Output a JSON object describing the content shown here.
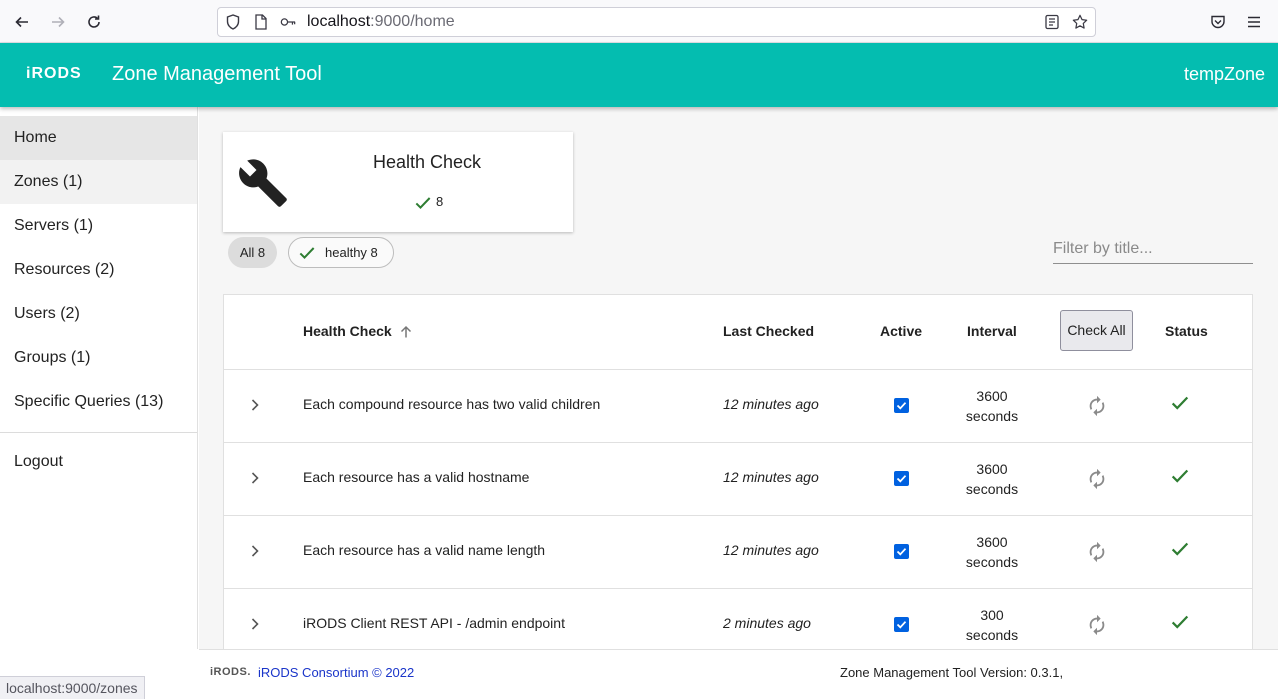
{
  "browser": {
    "url_host": "localhost",
    "url_rest": ":9000/home",
    "status_url": "localhost:9000/zones"
  },
  "header": {
    "logo": "iRODS",
    "title": "Zone Management Tool",
    "zone": "tempZone"
  },
  "sidebar": {
    "items": [
      {
        "label": "Home"
      },
      {
        "label": "Zones (1)"
      },
      {
        "label": "Servers (1)"
      },
      {
        "label": "Resources (2)"
      },
      {
        "label": "Users (2)"
      },
      {
        "label": "Groups (1)"
      },
      {
        "label": "Specific Queries (13)"
      }
    ],
    "logout": "Logout"
  },
  "summary_card": {
    "title": "Health Check",
    "healthy_count": "8"
  },
  "filters": {
    "all_label": "All 8",
    "healthy_label": "healthy 8",
    "search_placeholder": "Filter by title..."
  },
  "table": {
    "headers": {
      "name": "Health Check",
      "last_checked": "Last Checked",
      "active": "Active",
      "interval": "Interval",
      "check_all": "Check All",
      "status": "Status"
    },
    "rows": [
      {
        "name": "Each compound resource has two valid children",
        "last_checked": "12 minutes ago",
        "interval_value": "3600",
        "interval_unit": "seconds"
      },
      {
        "name": "Each resource has a valid hostname",
        "last_checked": "12 minutes ago",
        "interval_value": "3600",
        "interval_unit": "seconds"
      },
      {
        "name": "Each resource has a valid name length",
        "last_checked": "12 minutes ago",
        "interval_value": "3600",
        "interval_unit": "seconds"
      },
      {
        "name": "iRODS Client REST API - /admin endpoint",
        "last_checked": "2 minutes ago",
        "interval_value": "300",
        "interval_unit": "seconds"
      }
    ]
  },
  "footer": {
    "logo": "iRODS.",
    "link": "iRODS Consortium © 2022",
    "version": "Zone Management Tool Version: 0.3.1,"
  },
  "colors": {
    "header_bg": "#04bdb0",
    "check_green": "#2e7d32",
    "checkbox_blue": "#0061e0",
    "link_blue": "#1a35c9"
  }
}
